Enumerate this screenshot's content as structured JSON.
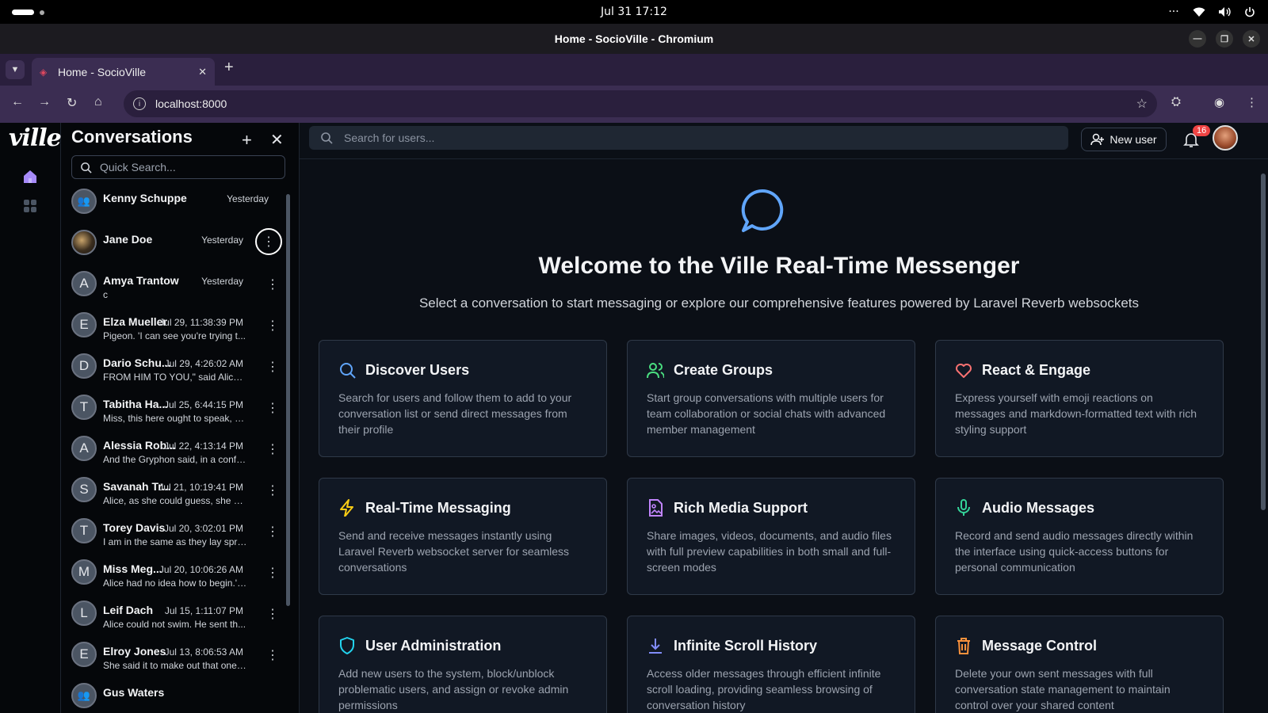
{
  "system": {
    "datetime": "Jul 31  17:12",
    "more": "···"
  },
  "window": {
    "title": "Home - SocioVille - Chromium"
  },
  "browser": {
    "tab_title": "Home - SocioVille",
    "url": "localhost:8000"
  },
  "app": {
    "logo": "ville",
    "conversations": {
      "title": "Conversations",
      "search_placeholder": "Quick Search...",
      "items": [
        {
          "name": "Kenny Schuppe",
          "date": "Yesterday",
          "preview": "",
          "avatar": "group"
        },
        {
          "name": "Jane Doe",
          "date": "Yesterday",
          "preview": "",
          "avatar": "image"
        },
        {
          "name": "Amya Trantow",
          "date": "Yesterday",
          "preview": "c",
          "avatar": "A"
        },
        {
          "name": "Elza Mueller",
          "date": "Jul 29, 11:38:39 PM",
          "preview": "Pigeon. 'I can see you're trying t...",
          "avatar": "E"
        },
        {
          "name": "Dario Schu...",
          "date": "Jul 29, 4:26:02 AM",
          "preview": "FROM HIM TO YOU,\" said Alice, ...",
          "avatar": "D"
        },
        {
          "name": "Tabitha Ha...",
          "date": "Jul 25, 6:44:15 PM",
          "preview": "Miss, this here ought to speak, b...",
          "avatar": "T"
        },
        {
          "name": "Alessia Rob...",
          "date": "Jul 22, 4:13:14 PM",
          "preview": "And the Gryphon said, in a confu...",
          "avatar": "A"
        },
        {
          "name": "Savanah Tr...",
          "date": "Jul 21, 10:19:41 PM",
          "preview": "Alice, as she could guess, she wa...",
          "avatar": "S"
        },
        {
          "name": "Torey Davis",
          "date": "Jul 20, 3:02:01 PM",
          "preview": "I am in the same as they lay spra...",
          "avatar": "T"
        },
        {
          "name": "Miss Meg...",
          "date": "Jul 20, 10:06:26 AM",
          "preview": "Alice had no idea how to begin.' ...",
          "avatar": "M"
        },
        {
          "name": "Leif Dach",
          "date": "Jul 15, 1:11:07 PM",
          "preview": "Alice could not swim. He sent th...",
          "avatar": "L"
        },
        {
          "name": "Elroy Jones",
          "date": "Jul 13, 8:06:53 AM",
          "preview": "She said it to make out that one ...",
          "avatar": "E"
        },
        {
          "name": "Gus Waters",
          "date": "",
          "preview": "",
          "avatar": "group"
        }
      ]
    },
    "header": {
      "search_placeholder": "Search for users...",
      "new_user_label": "New user",
      "notification_count": "16"
    },
    "welcome": {
      "title": "Welcome to the Ville Real-Time Messenger",
      "subtitle": "Select a conversation to start messaging or explore our comprehensive features powered by Laravel Reverb websockets"
    },
    "features": [
      {
        "title": "Discover Users",
        "desc": "Search for users and follow them to add to your conversation list or send direct messages from their profile",
        "icon": "search-icon",
        "color": "#60a5fa"
      },
      {
        "title": "Create Groups",
        "desc": "Start group conversations with multiple users for team collaboration or social chats with advanced member management",
        "icon": "users-icon",
        "color": "#4ade80"
      },
      {
        "title": "React & Engage",
        "desc": "Express yourself with emoji reactions on messages and markdown-formatted text with rich styling support",
        "icon": "heart-icon",
        "color": "#f87171"
      },
      {
        "title": "Real-Time Messaging",
        "desc": "Send and receive messages instantly using Laravel Reverb websocket server for seamless conversations",
        "icon": "bolt-icon",
        "color": "#facc15"
      },
      {
        "title": "Rich Media Support",
        "desc": "Share images, videos, documents, and audio files with full preview capabilities in both small and full-screen modes",
        "icon": "media-file-icon",
        "color": "#c084fc"
      },
      {
        "title": "Audio Messages",
        "desc": "Record and send audio messages directly within the interface using quick-access buttons for personal communication",
        "icon": "microphone-icon",
        "color": "#34d399"
      },
      {
        "title": "User Administration",
        "desc": "Add new users to the system, block/unblock problematic users, and assign or revoke admin permissions",
        "icon": "shield-icon",
        "color": "#22d3ee"
      },
      {
        "title": "Infinite Scroll History",
        "desc": "Access older messages through efficient infinite scroll loading, providing seamless browsing of conversation history",
        "icon": "download-icon",
        "color": "#818cf8"
      },
      {
        "title": "Message Control",
        "desc": "Delete your own sent messages with full conversation state management to maintain control over your shared content",
        "icon": "trash-icon",
        "color": "#fb923c"
      }
    ]
  }
}
